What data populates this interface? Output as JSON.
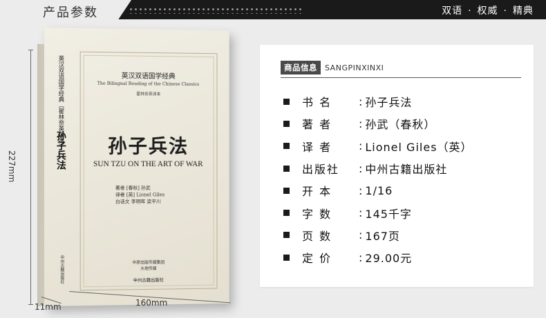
{
  "banner": {
    "title": "产品参数",
    "tagline_items": [
      "双语",
      "权威",
      "精典"
    ],
    "separator": "·"
  },
  "book": {
    "series_cn": "英汉双语国学经典",
    "series_en": "The Bilingual Reading of the Chinese Classics",
    "series_sub": "翟林奈英译本",
    "title_cn": "孙子兵法",
    "title_en": "SUN TZU ON THE ART OF WAR",
    "authors": [
      "著者 [春秋] 孙武",
      "译者 [英] Lionel Giles",
      "白话文 李明晖 梁平川"
    ],
    "publisher_group": [
      "中原出版传媒集团",
      "大地传媒"
    ],
    "publisher": "中州古籍出版社",
    "spine_series": "英汉双语国学经典（翟林奈英译本）",
    "spine_title": "孙子兵法",
    "spine_publisher": "中州古籍出版社"
  },
  "dimensions": {
    "height": "227mm",
    "width": "160mm",
    "depth": "11mm"
  },
  "info": {
    "badge": "商品信息",
    "subtitle": "SANGPINXINXI",
    "rows": [
      {
        "label": "书 名",
        "value": "孙子兵法"
      },
      {
        "label": "著 者",
        "value": "孙武（春秋）"
      },
      {
        "label": "译 者",
        "value": "Lionel Giles（英）"
      },
      {
        "label": "出版社",
        "value": "中州古籍出版社"
      },
      {
        "label": "开 本",
        "value": "1/16"
      },
      {
        "label": "字 数",
        "value": "145千字"
      },
      {
        "label": "页 数",
        "value": "167页"
      },
      {
        "label": "定 价",
        "value": "29.00元"
      }
    ]
  },
  "colors": {
    "banner_bg": "#1a1a1a",
    "page_bg": "#ececec",
    "badge_bg": "#4a4a4a",
    "cover_bg": "#ece8dc"
  }
}
